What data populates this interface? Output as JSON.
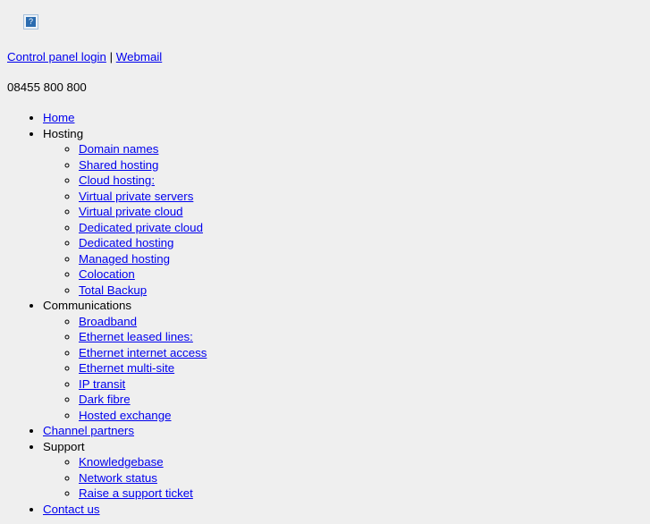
{
  "page": {
    "background_color": "#efefef",
    "link_color": "#0000ee",
    "text_color": "#000000"
  },
  "logo": {
    "icon": "broken-image-icon",
    "glyph": "?"
  },
  "top_links": {
    "control_panel_label": "Control panel login",
    "separator": "|",
    "webmail_label": "Webmail"
  },
  "phone": {
    "number": "08455 800 800"
  },
  "nav": {
    "items": [
      {
        "label": "Home",
        "is_link": true,
        "children": []
      },
      {
        "label": "Hosting",
        "is_link": false,
        "children": [
          {
            "label": "Domain names",
            "is_link": true
          },
          {
            "label": "Shared hosting",
            "is_link": true
          },
          {
            "label": "Cloud hosting:",
            "is_link": true
          },
          {
            "label": "Virtual private servers",
            "is_link": true
          },
          {
            "label": "Virtual private cloud",
            "is_link": true
          },
          {
            "label": "Dedicated private cloud",
            "is_link": true
          },
          {
            "label": "Dedicated hosting",
            "is_link": true
          },
          {
            "label": "Managed hosting",
            "is_link": true
          },
          {
            "label": "Colocation",
            "is_link": true
          },
          {
            "label": "Total Backup",
            "is_link": true
          }
        ]
      },
      {
        "label": "Communications",
        "is_link": false,
        "children": [
          {
            "label": "Broadband",
            "is_link": true
          },
          {
            "label": "Ethernet leased lines:",
            "is_link": true
          },
          {
            "label": "Ethernet internet access",
            "is_link": true
          },
          {
            "label": "Ethernet multi-site",
            "is_link": true
          },
          {
            "label": "IP transit",
            "is_link": true
          },
          {
            "label": "Dark fibre",
            "is_link": true
          },
          {
            "label": "Hosted exchange",
            "is_link": true
          }
        ]
      },
      {
        "label": "Channel partners",
        "is_link": true,
        "children": []
      },
      {
        "label": "Support",
        "is_link": false,
        "children": [
          {
            "label": "Knowledgebase",
            "is_link": true
          },
          {
            "label": "Network status",
            "is_link": true
          },
          {
            "label": "Raise a support ticket",
            "is_link": true
          }
        ]
      },
      {
        "label": "Contact us",
        "is_link": true,
        "children": []
      }
    ]
  }
}
